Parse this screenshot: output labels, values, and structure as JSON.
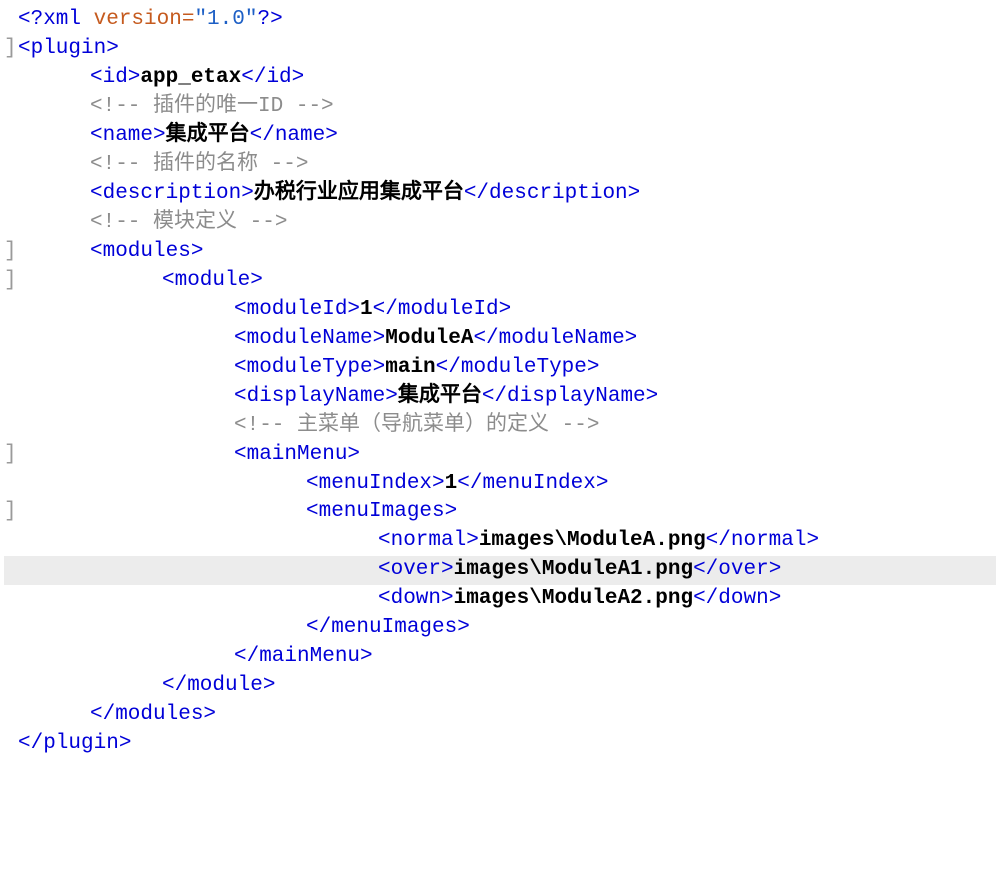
{
  "xml_decl": {
    "open": "<?xml ",
    "attr": "version=",
    "val": "\"1.0\"",
    "close": "?>"
  },
  "plugin": {
    "open": "<plugin>",
    "close": "</plugin>"
  },
  "id": {
    "open": "<id>",
    "val": "app_etax",
    "close": "</id>"
  },
  "c_id": {
    "open": "<!-- ",
    "text": "插件的唯一ID",
    "close": " -->"
  },
  "name": {
    "open": "<name>",
    "val": "集成平台",
    "close": "</name>"
  },
  "c_name": {
    "open": "<!-- ",
    "text": "插件的名称",
    "close": " -->"
  },
  "desc": {
    "open": "<description>",
    "val": "办税行业应用集成平台",
    "close": "</description>"
  },
  "c_mod": {
    "open": "<!-- ",
    "text": "模块定义",
    "close": " -->"
  },
  "modules": {
    "open": "<modules>",
    "close": "</modules>"
  },
  "module": {
    "open": "<module>",
    "close": "</module>"
  },
  "moduleId": {
    "open": "<moduleId>",
    "val": "1",
    "close": "</moduleId>"
  },
  "moduleName": {
    "open": "<moduleName>",
    "val": "ModuleA",
    "close": "</moduleName>"
  },
  "moduleType": {
    "open": "<moduleType>",
    "val": "main",
    "close": "</moduleType>"
  },
  "displayName": {
    "open": "<displayName>",
    "val": "集成平台",
    "close": "</displayName>"
  },
  "c_menu": {
    "open": "<!-- ",
    "text": "主菜单（导航菜单）的定义",
    "close": " -->"
  },
  "mainMenu": {
    "open": "<mainMenu>",
    "close": "</mainMenu>"
  },
  "menuIndex": {
    "open": "<menuIndex>",
    "val": "1",
    "close": "</menuIndex>"
  },
  "menuImages": {
    "open": "<menuImages>",
    "close": "</menuImages>"
  },
  "normal": {
    "open": "<normal>",
    "val": "images\\ModuleA.png",
    "close": "</normal>"
  },
  "over": {
    "open": "<over>",
    "val": "images\\ModuleA1.png",
    "close": "</over>"
  },
  "down": {
    "open": "<down>",
    "val": "images\\ModuleA2.png",
    "close": "</down>"
  },
  "gutter_mark": "]"
}
